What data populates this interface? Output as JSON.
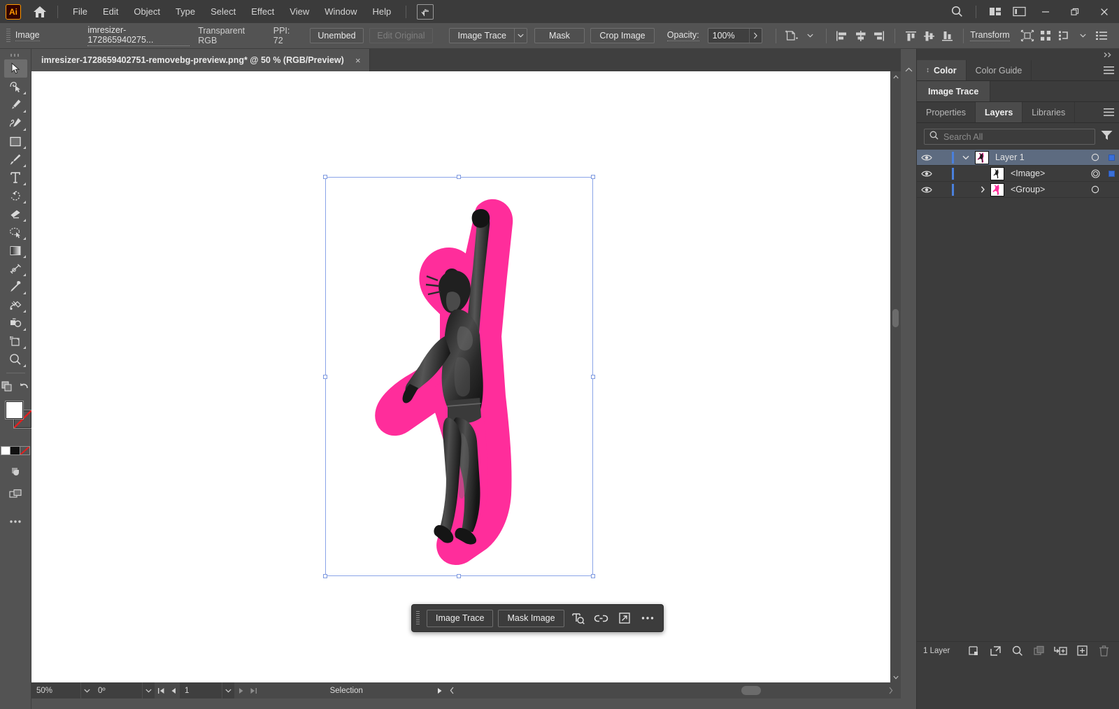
{
  "app": {
    "name": "Adobe Illustrator",
    "logo_text": "Ai",
    "accent_pink": "#ff2d9b",
    "selection_blue": "#8aa4e8"
  },
  "menubar": {
    "home_icon": "home-icon",
    "search_icon": "search-icon",
    "touch_icon": "touch-workspace-icon",
    "items": [
      {
        "label": "File"
      },
      {
        "label": "Edit"
      },
      {
        "label": "Object"
      },
      {
        "label": "Type"
      },
      {
        "label": "Select"
      },
      {
        "label": "Effect"
      },
      {
        "label": "View"
      },
      {
        "label": "Window"
      },
      {
        "label": "Help"
      }
    ],
    "window_controls": {
      "minimize": "–",
      "maximize": "❐",
      "close": "×"
    },
    "right_icons": [
      {
        "name": "arrange-documents-icon"
      },
      {
        "name": "panel-layout-icon"
      }
    ]
  },
  "controlbar": {
    "object_type": "Image",
    "filename": "imresizer-172865940275...",
    "color_mode": "Transparent RGB",
    "ppi": "PPI: 72",
    "unembed_label": "Unembed",
    "edit_original_label": "Edit Original",
    "image_trace_label": "Image Trace",
    "mask_label": "Mask",
    "crop_image_label": "Crop Image",
    "opacity_label": "Opacity:",
    "opacity_value": "100%",
    "transform_label": "Transform",
    "icons": [
      {
        "name": "recolor-artwork-icon"
      },
      {
        "name": "align-left-icon"
      },
      {
        "name": "align-horizontal-center-icon"
      },
      {
        "name": "align-right-icon"
      },
      {
        "name": "align-top-icon"
      },
      {
        "name": "align-vertical-center-icon"
      },
      {
        "name": "align-bottom-icon"
      },
      {
        "name": "isolate-selected-icon"
      },
      {
        "name": "distribute-spacing-icon"
      },
      {
        "name": "align-to-dropdown-icon"
      },
      {
        "name": "properties-list-icon"
      }
    ]
  },
  "tools": [
    {
      "name": "selection-tool",
      "glyph": "selection-arrow-icon",
      "active": true,
      "corner": false
    },
    {
      "name": "direct-selection-tool",
      "glyph": "lasso-arrow-icon",
      "active": false,
      "corner": true
    },
    {
      "name": "pen-tool",
      "glyph": "pen-icon",
      "active": false,
      "corner": true
    },
    {
      "name": "curvature-tool",
      "glyph": "curvature-pen-icon",
      "active": false,
      "corner": true
    },
    {
      "name": "rectangle-tool",
      "glyph": "rectangle-icon",
      "active": false,
      "corner": true
    },
    {
      "name": "paintbrush-tool",
      "glyph": "paintbrush-icon",
      "active": false,
      "corner": true
    },
    {
      "name": "type-tool",
      "glyph": "type-T-icon",
      "active": false,
      "corner": true
    },
    {
      "name": "rotate-tool",
      "glyph": "rotate-icon",
      "active": false,
      "corner": true
    },
    {
      "name": "eraser-tool",
      "glyph": "eraser-icon",
      "active": false,
      "corner": true
    },
    {
      "name": "shaper-tool",
      "glyph": "shaper-icon",
      "active": false,
      "corner": true
    },
    {
      "name": "gradient-tool",
      "glyph": "gradient-icon",
      "active": false,
      "corner": true
    },
    {
      "name": "width-tool",
      "glyph": "width-icon",
      "active": false,
      "corner": true
    },
    {
      "name": "eyedropper-tool",
      "glyph": "eyedropper-icon",
      "active": false,
      "corner": true
    },
    {
      "name": "free-transform-tool",
      "glyph": "free-transform-icon",
      "active": false,
      "corner": true
    },
    {
      "name": "shape-builder-tool",
      "glyph": "shape-builder-icon",
      "active": false,
      "corner": true
    },
    {
      "name": "artboard-tool",
      "glyph": "artboard-icon",
      "active": false,
      "corner": true
    },
    {
      "name": "zoom-tool",
      "glyph": "magnifier-icon",
      "active": false,
      "corner": true
    }
  ],
  "tool_extras": {
    "arrange_icon": "arrange-objects-icon",
    "reset_icon": "reset-icon",
    "fill_color": "#ffffff",
    "stroke_color": "none",
    "gradient_icon": "gradient-swatch-icon",
    "drawing_mode_icon": "draw-normal-icon",
    "screen_mode_icon": "screen-mode-icon",
    "more_tools_icon": "more-tools-ellipsis-icon"
  },
  "document": {
    "tab_title": "imresizer-1728659402751-removebg-preview.png* @ 50 % (RGB/Preview)",
    "close_glyph": "×"
  },
  "floating_toolbar": {
    "image_trace_label": "Image Trace",
    "mask_image_label": "Mask Image",
    "icons": [
      {
        "name": "text-recognition-icon"
      },
      {
        "name": "link-icon"
      },
      {
        "name": "open-in-icon"
      },
      {
        "name": "more-options-ellipsis-icon"
      }
    ]
  },
  "statusbar": {
    "zoom": "50%",
    "rotation": "0º",
    "page": "1",
    "status_text": "Selection",
    "nav_icons": [
      {
        "name": "first-artboard-icon"
      },
      {
        "name": "previous-artboard-icon"
      },
      {
        "name": "next-artboard-icon"
      },
      {
        "name": "last-artboard-icon"
      }
    ]
  },
  "right_panel": {
    "collapse_icon": "collapse-panels-icon",
    "group_top": {
      "tabs": [
        {
          "label": "Color",
          "active": true
        },
        {
          "label": "Color Guide",
          "active": false
        }
      ],
      "menu_icon": "panel-menu-icon"
    },
    "group_mid": {
      "tabs": [
        {
          "label": "Image Trace",
          "active": true
        }
      ]
    },
    "group_layers": {
      "tabs": [
        {
          "label": "Properties",
          "active": false
        },
        {
          "label": "Layers",
          "active": true
        },
        {
          "label": "Libraries",
          "active": false
        }
      ],
      "menu_icon": "panel-menu-icon"
    },
    "search": {
      "placeholder": "Search All",
      "value": "",
      "icon": "search-icon",
      "filter_icon": "filter-icon"
    },
    "layers": [
      {
        "name": "Layer 1",
        "indent": 0,
        "selected": true,
        "expanded": true,
        "has_disclosure": true,
        "visible": true,
        "target_style": "circle",
        "has_selection_square": true,
        "thumb": "figure-thumb"
      },
      {
        "name": "<Image>",
        "indent": 1,
        "selected": false,
        "expanded": false,
        "has_disclosure": false,
        "visible": true,
        "target_style": "double-circle",
        "has_selection_square": true,
        "thumb": "image-thumb"
      },
      {
        "name": "<Group>",
        "indent": 1,
        "selected": false,
        "expanded": false,
        "has_disclosure": true,
        "visible": true,
        "target_style": "circle",
        "has_selection_square": false,
        "thumb": "group-thumb"
      }
    ],
    "footer": {
      "count_label": "1 Layer",
      "icons": [
        {
          "name": "locate-object-icon",
          "disabled": false
        },
        {
          "name": "release-to-layers-icon",
          "disabled": false
        },
        {
          "name": "search-layers-icon",
          "disabled": false
        },
        {
          "name": "collect-in-new-layer-icon",
          "disabled": true
        },
        {
          "name": "new-sublayer-icon",
          "disabled": false
        },
        {
          "name": "new-layer-icon",
          "disabled": false
        },
        {
          "name": "delete-layer-icon",
          "disabled": true
        }
      ]
    }
  },
  "artwork": {
    "description": "Black and white photo of a dancer with one arm raised, outlined by a thick magenta vector sticker shape",
    "outline_color": "#ff2d9b",
    "selection_handles": 8
  }
}
